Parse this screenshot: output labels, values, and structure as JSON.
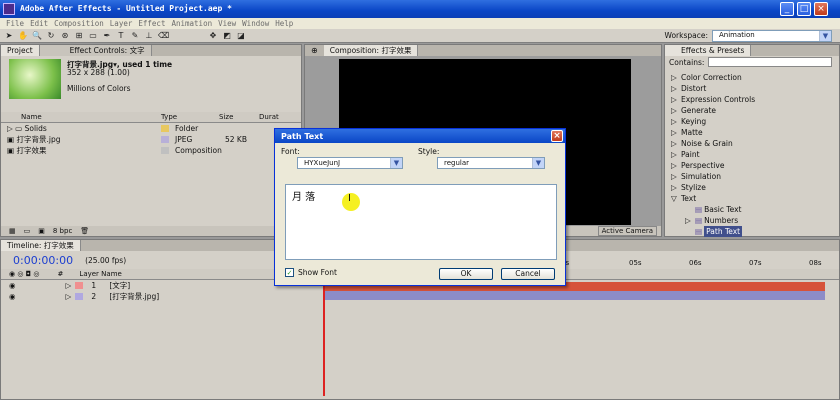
{
  "window": {
    "title": "Adobe After Effects - Untitled Project.aep *",
    "min": "_",
    "max": "□",
    "close": "×"
  },
  "menu": [
    "File",
    "Edit",
    "Composition",
    "Layer",
    "Effect",
    "Animation",
    "View",
    "Window",
    "Help"
  ],
  "toolbar": {
    "workspace_label": "Workspace:",
    "workspace_value": "Animation"
  },
  "project": {
    "tab": "Project",
    "tab2": "Effect Controls: 文字",
    "asset_name": "打字背景.jpg▾, used 1 time",
    "asset_size": "352 x 288 (1.00)",
    "asset_colors": "Millions of Colors",
    "columns": {
      "name": "Name",
      "type": "Type",
      "size": "Size",
      "dur": "Durat"
    },
    "rows": [
      {
        "name": "Solids",
        "type": "Folder",
        "size": "",
        "tag": "#e8c860"
      },
      {
        "name": "打字背景.jpg",
        "type": "JPEG",
        "size": "52 KB",
        "tag": "#b8b0d8"
      },
      {
        "name": "打字效果",
        "type": "Composition",
        "size": "",
        "tag": "#c0c0c0"
      }
    ],
    "bpc": "8 bpc"
  },
  "composition": {
    "tab": "Composition: 打字效果",
    "camera": "Active Camera"
  },
  "effects": {
    "tab": "Effects & Presets",
    "contains_label": "Contains:",
    "items": [
      {
        "label": "Color Correction",
        "level": 0,
        "arrow": "▷"
      },
      {
        "label": "Distort",
        "level": 0,
        "arrow": "▷"
      },
      {
        "label": "Expression Controls",
        "level": 0,
        "arrow": "▷"
      },
      {
        "label": "Generate",
        "level": 0,
        "arrow": "▷"
      },
      {
        "label": "Keying",
        "level": 0,
        "arrow": "▷"
      },
      {
        "label": "Matte",
        "level": 0,
        "arrow": "▷"
      },
      {
        "label": "Noise & Grain",
        "level": 0,
        "arrow": "▷"
      },
      {
        "label": "Paint",
        "level": 0,
        "arrow": "▷"
      },
      {
        "label": "Perspective",
        "level": 0,
        "arrow": "▷"
      },
      {
        "label": "Simulation",
        "level": 0,
        "arrow": "▷"
      },
      {
        "label": "Stylize",
        "level": 0,
        "arrow": "▷"
      },
      {
        "label": "Text",
        "level": 0,
        "arrow": "▽"
      },
      {
        "label": "Basic Text",
        "level": 1,
        "arrow": ""
      },
      {
        "label": "Numbers",
        "level": 1,
        "arrow": "▷"
      },
      {
        "label": "Path Text",
        "level": 1,
        "arrow": "",
        "selected": true
      },
      {
        "label": "Timecode",
        "level": 1,
        "arrow": ""
      }
    ]
  },
  "timeline": {
    "tab": "Timeline: 打字效果",
    "timecode": "0:00:00:00",
    "fps": "(25.00 fps)",
    "layer_name_header": "Layer Name",
    "num_header": "#",
    "layers": [
      {
        "num": "1",
        "name": "[文字]",
        "color": "#f09090"
      },
      {
        "num": "2",
        "name": "[打字背景.jpg]",
        "color": "#b0a8e0"
      }
    ],
    "ruler": [
      "4s",
      "05s",
      "06s",
      "07s",
      "08s"
    ]
  },
  "dialog": {
    "title": "Path Text",
    "close": "×",
    "font_label": "Font:",
    "font_value": "HYXueJunJ",
    "style_label": "Style:",
    "style_value": "regular",
    "text_value": "月 落",
    "show_font_label": "Show Font",
    "ok_label": "OK",
    "cancel_label": "Cancel"
  }
}
